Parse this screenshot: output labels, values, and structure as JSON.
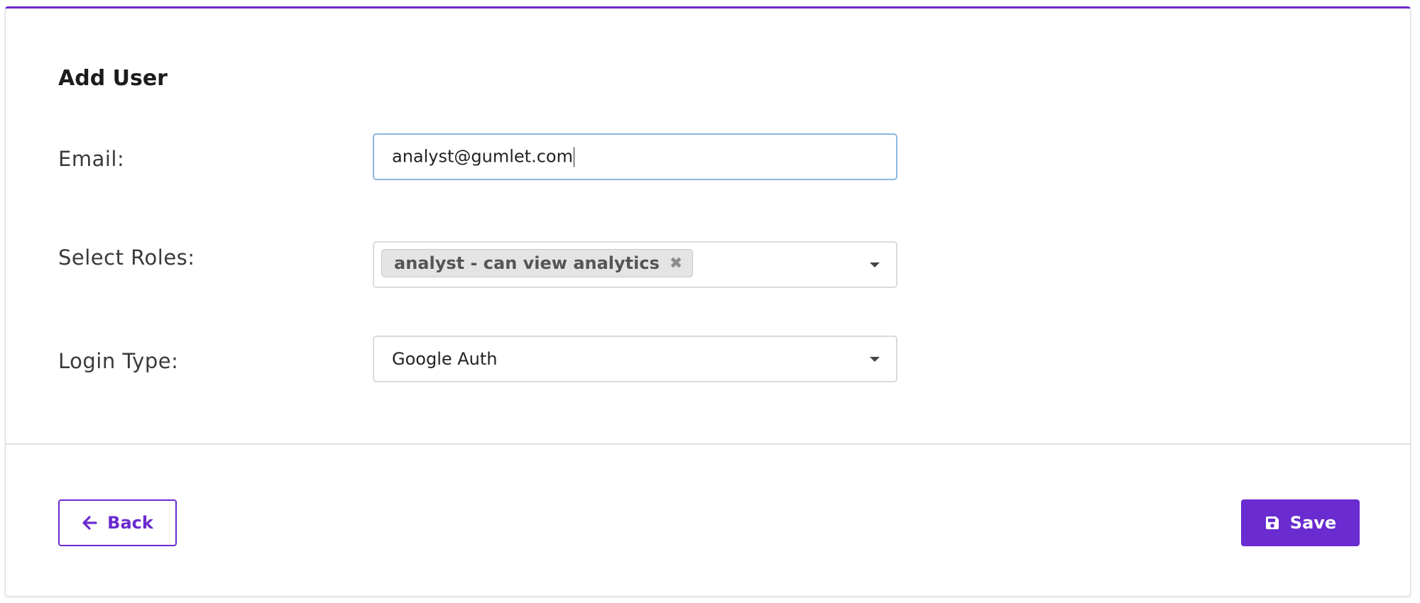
{
  "form": {
    "title": "Add User",
    "email": {
      "label": "Email:",
      "value": "analyst@gumlet.com"
    },
    "roles": {
      "label": "Select Roles:",
      "selected": [
        "analyst - can view analytics"
      ]
    },
    "login_type": {
      "label": "Login Type:",
      "value": "Google Auth"
    }
  },
  "actions": {
    "back_label": "Back",
    "save_label": "Save"
  },
  "icons": {
    "back": "arrow-left-icon",
    "save": "floppy-disk-icon",
    "chip_remove": "close-icon",
    "dropdown": "caret-down-icon"
  },
  "colors": {
    "accent": "#6a2bd0",
    "focus_border": "#8db8e0"
  }
}
